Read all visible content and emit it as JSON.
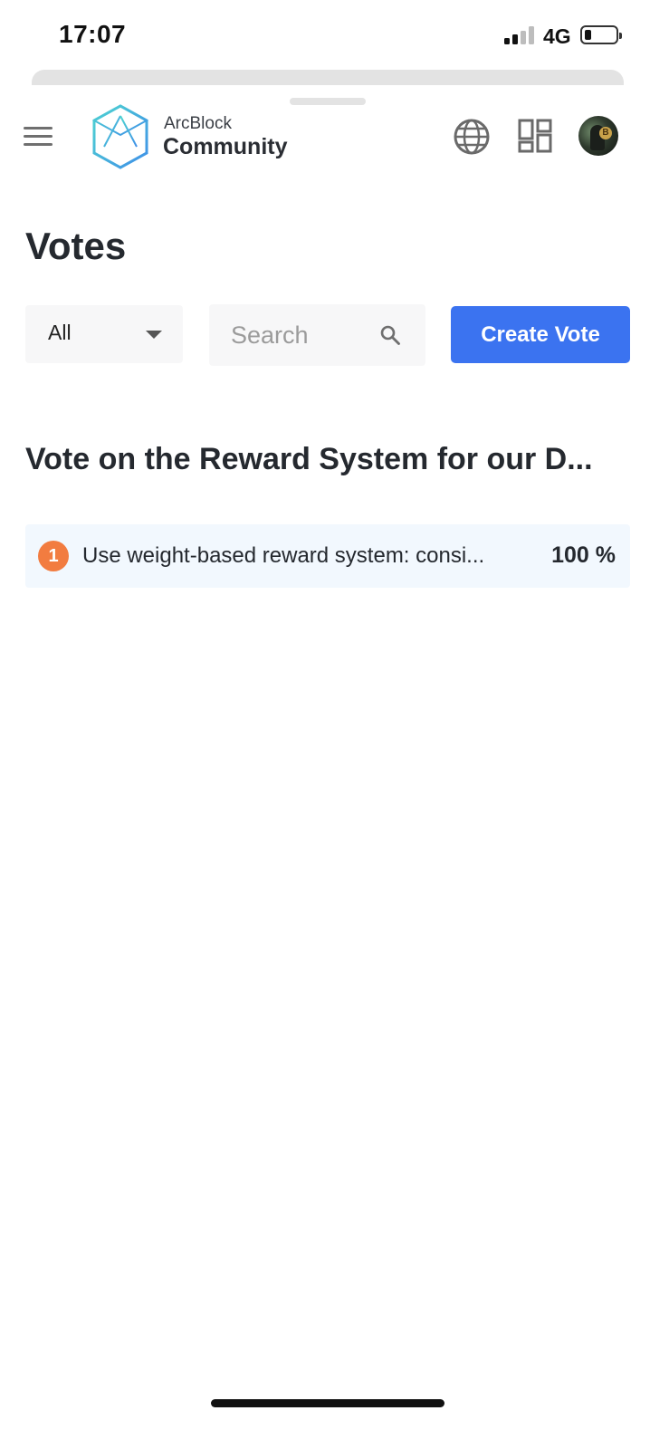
{
  "status_bar": {
    "time": "17:07",
    "network": "4G"
  },
  "header": {
    "brand_small": "ArcBlock",
    "brand_big": "Community"
  },
  "page": {
    "title": "Votes"
  },
  "toolbar": {
    "filter_value": "All",
    "search_placeholder": "Search",
    "create_label": "Create Vote"
  },
  "vote": {
    "title": "Vote on the Reward System for our D...",
    "options": [
      {
        "rank": "1",
        "text": "Use weight-based reward system: consi...",
        "percent": "100 %"
      }
    ]
  },
  "colors": {
    "accent": "#3b73f0",
    "rank_badge": "#f27c40",
    "option_bg": "#f2f8fe"
  },
  "icons": [
    "menu-icon",
    "globe-icon",
    "apps-icon",
    "search-icon",
    "chevron-down-icon"
  ]
}
